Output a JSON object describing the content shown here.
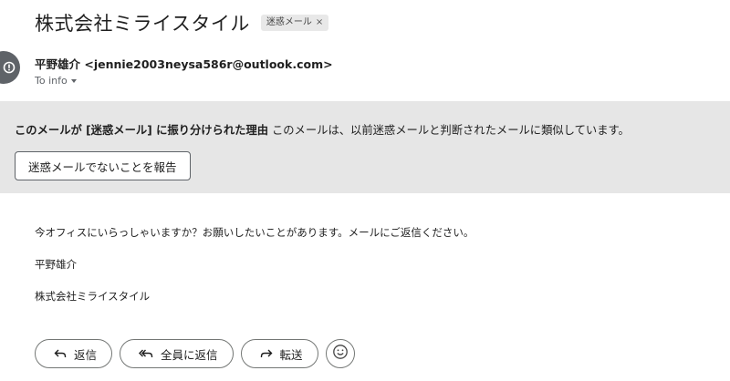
{
  "email": {
    "subject": "株式会社ミライスタイル",
    "label": "迷惑メール",
    "label_remove": "×",
    "sender_line": "平野雄介 <jennie2003neysa586r@outlook.com>",
    "to_line": "To info"
  },
  "spam_banner": {
    "reason_title": "このメールが [迷惑メール] に振り分けられた理由",
    "reason_text": " このメールは、以前迷惑メールと判断されたメールに類似しています。",
    "report_button": "迷惑メールでないことを報告"
  },
  "body": {
    "line1": "今オフィスにいらっしゃいますか？お願いしたいことがあります。メールにご返信ください。",
    "line2": "平野雄介",
    "line3": "株式会社ミライスタイル"
  },
  "actions": {
    "reply": "返信",
    "reply_all": "全員に返信",
    "forward": "転送"
  },
  "icons": {
    "avatar": "alert-icon",
    "reply": "reply-icon",
    "reply_all": "reply-all-icon",
    "forward": "forward-icon",
    "emoji": "emoji-icon",
    "caret": "caret-down-icon"
  }
}
